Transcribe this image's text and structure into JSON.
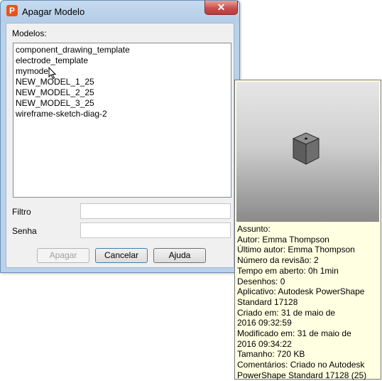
{
  "window": {
    "title": "Apagar Modelo",
    "close_glyph": "✕",
    "app_icon": "P"
  },
  "dialog": {
    "models_label": "Modelos:",
    "models": [
      "component_drawing_template",
      "electrode_template",
      "mymodel",
      "NEW_MODEL_1_25",
      "NEW_MODEL_2_25",
      "NEW_MODEL_3_25",
      "wireframe-sketch-diag-2"
    ],
    "filter_label": "Filtro",
    "filter_value": "",
    "password_label": "Senha",
    "password_value": "",
    "delete_button": "Apagar",
    "cancel_button": "Cancelar",
    "help_button": "Ajuda"
  },
  "tooltip": {
    "lines": [
      "Assunto:",
      "Autor: Emma Thompson",
      "Último autor: Emma Thompson",
      "Número da revisão: 2",
      "Tempo em aberto: 0h 1min",
      "Desenhos: 0",
      "Aplicativo: Autodesk PowerShape",
      "Standard 17128",
      "Criado em: 31 de maio de",
      "2016 09:32:59",
      "Modificado em: 31 de maio de",
      "2016 09:34:22",
      "Tamanho: 720 KB",
      "Comentários: Criado no Autodesk",
      "PowerShape Standard 17128 (25)"
    ]
  },
  "colors": {
    "title_bar": "#b9d1ea",
    "close_button": "#c75050",
    "tooltip_bg": "#ffffe1"
  }
}
